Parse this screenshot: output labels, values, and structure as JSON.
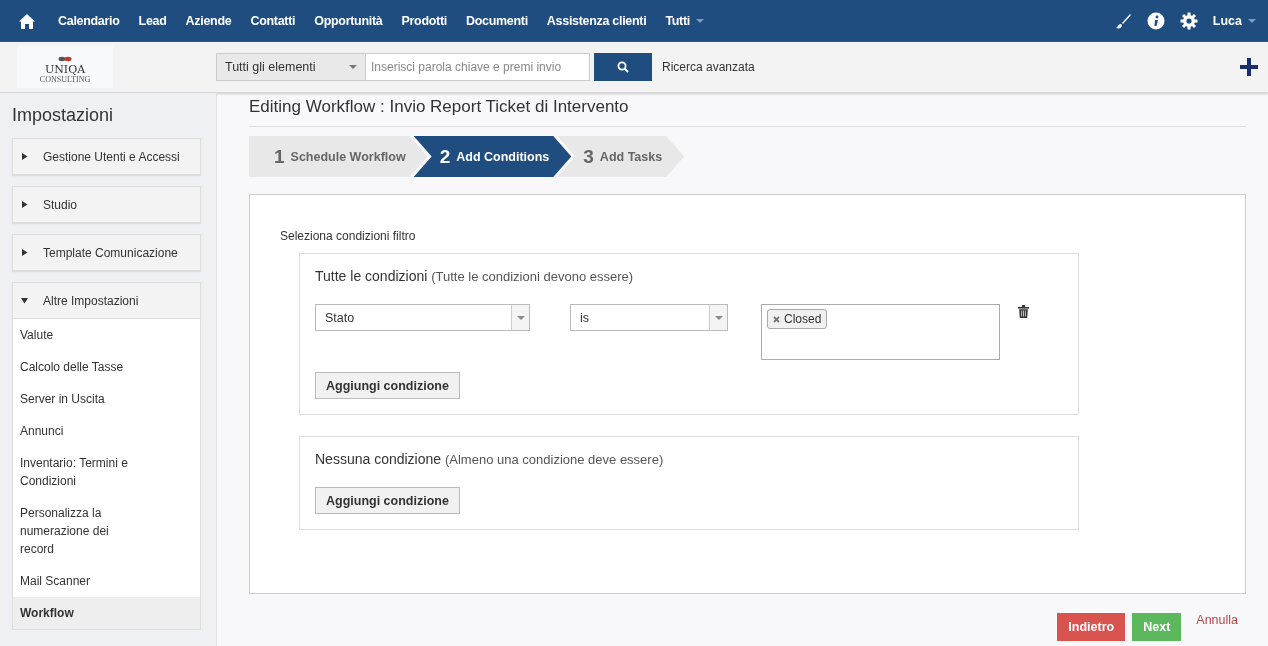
{
  "nav": {
    "items": [
      {
        "label": "Calendario",
        "has_menu": false
      },
      {
        "label": "Lead",
        "has_menu": false
      },
      {
        "label": "Aziende",
        "has_menu": false
      },
      {
        "label": "Contatti",
        "has_menu": false
      },
      {
        "label": "Opportunità",
        "has_menu": false
      },
      {
        "label": "Prodotti",
        "has_menu": false
      },
      {
        "label": "Documenti",
        "has_menu": false
      },
      {
        "label": "Assistenza clienti",
        "has_menu": false
      },
      {
        "label": "Tutti",
        "has_menu": true
      }
    ],
    "user": "Luca"
  },
  "search": {
    "scope": "Tutti gli elementi",
    "placeholder": "Inserisci parola chiave e premi invio",
    "advanced": "Ricerca avanzata"
  },
  "logo": {
    "name": "UNIQA",
    "tagline": "CONSULTING"
  },
  "sidebar": {
    "title": "Impostazioni",
    "sections": [
      {
        "label": "Gestione Utenti e Accessi",
        "expanded": false
      },
      {
        "label": "Studio",
        "expanded": false
      },
      {
        "label": "Template Comunicazione",
        "expanded": false
      },
      {
        "label": "Altre Impostazioni",
        "expanded": true,
        "items": [
          {
            "label": "Valute",
            "selected": false
          },
          {
            "label": "Calcolo delle Tasse",
            "selected": false
          },
          {
            "label": "Server in Uscita",
            "selected": false
          },
          {
            "label": "Annunci",
            "selected": false
          },
          {
            "label": "Inventario: Termini e Condizioni",
            "selected": false
          },
          {
            "label": "Personalizza la numerazione dei record",
            "selected": false
          },
          {
            "label": "Mail Scanner",
            "selected": false
          },
          {
            "label": "Workflow",
            "selected": true
          }
        ]
      }
    ]
  },
  "page_title": "Editing Workflow : Invio Report Ticket di Intervento",
  "steps": [
    {
      "number": "1",
      "label": "Schedule Workflow",
      "selected": false
    },
    {
      "number": "2",
      "label": "Add Conditions",
      "selected": true
    },
    {
      "number": "3",
      "label": "Add Tasks",
      "selected": false
    }
  ],
  "filter_label": "Seleziona condizioni filtro",
  "groups": [
    {
      "title": "Tutte le condizioni",
      "note": "(Tutte le condizioni devono essere)",
      "conditions": [
        {
          "field": "Stato",
          "operator": "is",
          "values": [
            "Closed"
          ]
        }
      ],
      "add_button": "Aggiungi condizione"
    },
    {
      "title": "Nessuna condizione",
      "note": "(Almeno una condizione deve essere)",
      "add_button": "Aggiungi condizione"
    }
  ],
  "footer": [
    {
      "label": "Indietro",
      "kind": "danger"
    },
    {
      "label": "Next",
      "kind": "success"
    },
    {
      "label": "Annulla",
      "kind": "link"
    }
  ]
}
